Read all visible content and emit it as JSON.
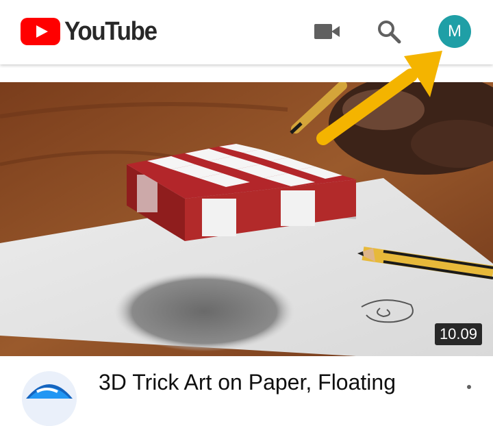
{
  "header": {
    "brand": "YouTube",
    "icons": {
      "camera": "video-camera-icon",
      "search": "search-icon"
    },
    "account_initial": "M",
    "account_color": "#1f9fa6"
  },
  "video": {
    "duration": "10.09",
    "title": "3D Trick Art on Paper, Floating",
    "more_icon": "more-vert-icon"
  },
  "colors": {
    "brand_red": "#ff0000",
    "arrow_yellow": "#f4b400"
  }
}
